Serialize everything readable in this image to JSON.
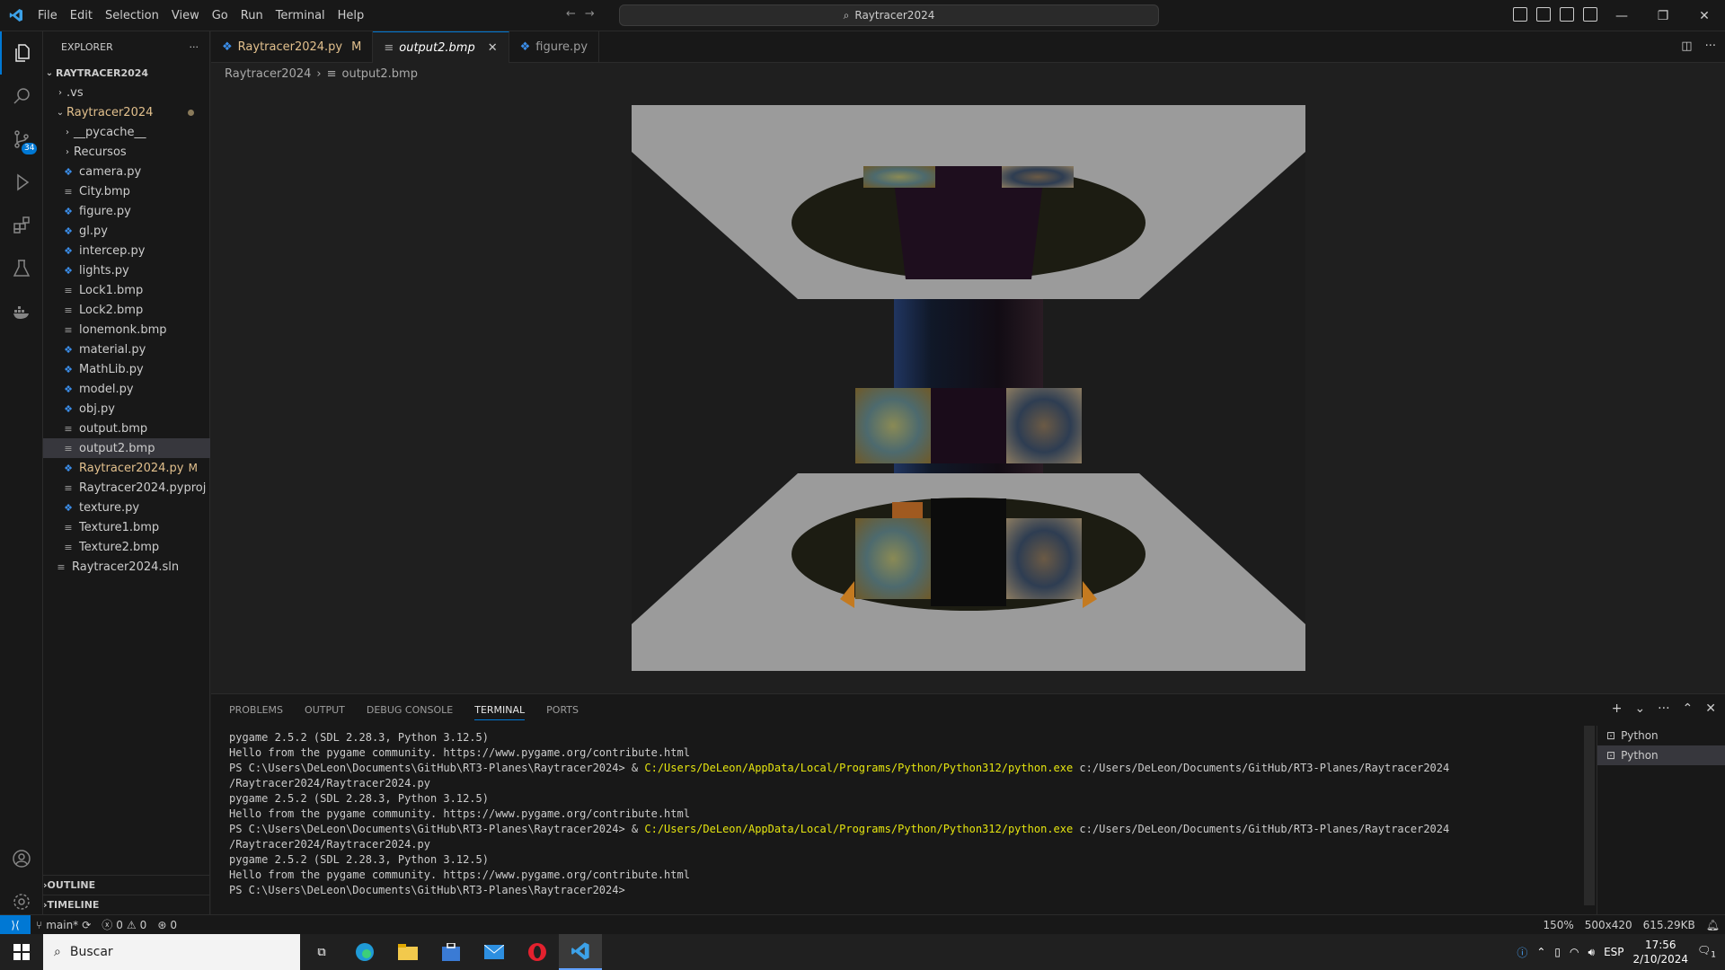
{
  "menu": [
    "File",
    "Edit",
    "Selection",
    "View",
    "Go",
    "Run",
    "Terminal",
    "Help"
  ],
  "command_center": "Raytracer2024",
  "activity_bar": {
    "scm_badge": "34"
  },
  "explorer": {
    "title": "EXPLORER",
    "root": "RAYTRACER2024",
    "items": [
      {
        "label": ".vs",
        "type": "folder",
        "indent": 1
      },
      {
        "label": "Raytracer2024",
        "type": "folder-open",
        "indent": 1
      },
      {
        "label": "__pycache__",
        "type": "folder",
        "indent": 2
      },
      {
        "label": "Recursos",
        "type": "folder",
        "indent": 2
      },
      {
        "label": "camera.py",
        "type": "py",
        "indent": 2
      },
      {
        "label": "City.bmp",
        "type": "bmp",
        "indent": 2
      },
      {
        "label": "figure.py",
        "type": "py",
        "indent": 2
      },
      {
        "label": "gl.py",
        "type": "py",
        "indent": 2
      },
      {
        "label": "intercep.py",
        "type": "py",
        "indent": 2
      },
      {
        "label": "lights.py",
        "type": "py",
        "indent": 2
      },
      {
        "label": "Lock1.bmp",
        "type": "bmp",
        "indent": 2
      },
      {
        "label": "Lock2.bmp",
        "type": "bmp",
        "indent": 2
      },
      {
        "label": "lonemonk.bmp",
        "type": "bmp",
        "indent": 2
      },
      {
        "label": "material.py",
        "type": "py",
        "indent": 2
      },
      {
        "label": "MathLib.py",
        "type": "py",
        "indent": 2
      },
      {
        "label": "model.py",
        "type": "py",
        "indent": 2
      },
      {
        "label": "obj.py",
        "type": "py",
        "indent": 2
      },
      {
        "label": "output.bmp",
        "type": "bmp",
        "indent": 2
      },
      {
        "label": "output2.bmp",
        "type": "bmp",
        "indent": 2
      },
      {
        "label": "Raytracer2024.py",
        "type": "py",
        "indent": 2
      },
      {
        "label": "Raytracer2024.pyproj",
        "type": "bmp",
        "indent": 2
      },
      {
        "label": "texture.py",
        "type": "py",
        "indent": 2
      },
      {
        "label": "Texture1.bmp",
        "type": "bmp",
        "indent": 2
      },
      {
        "label": "Texture2.bmp",
        "type": "bmp",
        "indent": 2
      },
      {
        "label": "Raytracer2024.sln",
        "type": "bmp",
        "indent": 1
      }
    ],
    "modified_marker": "M",
    "outline": "OUTLINE",
    "timeline": "TIMELINE"
  },
  "tabs": [
    {
      "label": "Raytracer2024.py",
      "marker": "M"
    },
    {
      "label": "output2.bmp",
      "marker": ""
    },
    {
      "label": "figure.py",
      "marker": ""
    }
  ],
  "breadcrumb": {
    "folder": "Raytracer2024",
    "file": "output2.bmp"
  },
  "panel": {
    "tabs": [
      "PROBLEMS",
      "OUTPUT",
      "DEBUG CONSOLE",
      "TERMINAL",
      "PORTS"
    ],
    "terminal_lines": [
      {
        "text": "pygame 2.5.2 (SDL 2.28.3, Python 3.12.5)"
      },
      {
        "text": "Hello from the pygame community. https://www.pygame.org/contribute.html"
      },
      {
        "prompt": "PS C:\\Users\\DeLeon\\Documents\\GitHub\\RT3-Planes\\Raytracer2024> & ",
        "exe": "C:/Users/DeLeon/AppData/Local/Programs/Python/Python312/python.exe",
        "rest": " c:/Users/DeLeon/Documents/GitHub/RT3-Planes/Raytracer2024"
      },
      {
        "text": "/Raytracer2024/Raytracer2024.py"
      },
      {
        "text": "pygame 2.5.2 (SDL 2.28.3, Python 3.12.5)"
      },
      {
        "text": "Hello from the pygame community. https://www.pygame.org/contribute.html"
      },
      {
        "prompt": "PS C:\\Users\\DeLeon\\Documents\\GitHub\\RT3-Planes\\Raytracer2024> & ",
        "exe": "C:/Users/DeLeon/AppData/Local/Programs/Python/Python312/python.exe",
        "rest": " c:/Users/DeLeon/Documents/GitHub/RT3-Planes/Raytracer2024"
      },
      {
        "text": "/Raytracer2024/Raytracer2024.py"
      },
      {
        "text": "pygame 2.5.2 (SDL 2.28.3, Python 3.12.5)"
      },
      {
        "text": "Hello from the pygame community. https://www.pygame.org/contribute.html"
      },
      {
        "text": "PS C:\\Users\\DeLeon\\Documents\\GitHub\\RT3-Planes\\Raytracer2024>"
      }
    ],
    "terminals": [
      "Python",
      "Python"
    ]
  },
  "statusbar": {
    "branch": "main*",
    "errors": "0",
    "warnings": "0",
    "ports": "0",
    "zoom": "150%",
    "dimensions": "500x420",
    "filesize": "615.29KB"
  },
  "taskbar": {
    "search": "Buscar",
    "lang": "ESP",
    "time": "17:56",
    "date": "2/10/2024",
    "notif_count": "1"
  }
}
